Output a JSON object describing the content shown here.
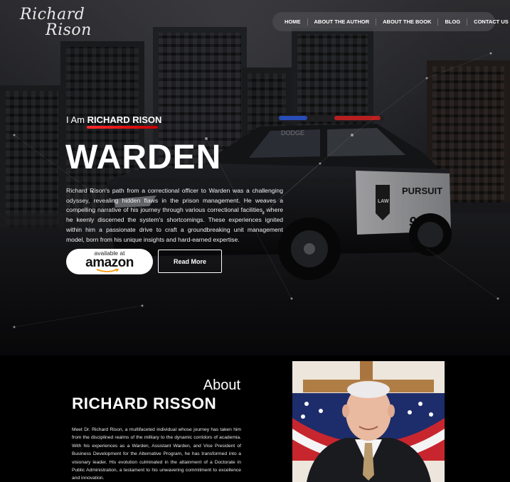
{
  "logo": {
    "line1": "Richard",
    "line2": "Rison"
  },
  "nav": [
    "HOME",
    "ABOUT THE AUTHOR",
    "ABOUT THE BOOK",
    "BLOG",
    "CONTACT US"
  ],
  "hero": {
    "i_am": "I Am",
    "name": "RICHARD RISON",
    "title": "WARDEN",
    "paragraph": "Richard Rison's path from a correctional officer to Warden was a challenging odyssey, revealing hidden flaws in the prison management. He weaves a compelling narrative of his journey through various correctional facilities, where he keenly discerned the system's shortcomings. These experiences ignited within him a passionate drive to craft a groundbreaking unit management model, born from his unique insights and hard-earned expertise.",
    "amazon_small": "available at",
    "amazon_big": "amazon",
    "read_more": "Read More"
  },
  "about": {
    "sub": "About",
    "name": "RICHARD RISSON",
    "paragraph": "Meet Dr. Richard Rison, a multifaceted individual whose journey has taken him from the disciplined realms of the military to the dynamic corridors of academia. With his experiences as a Warden, Assistant Warden, and Vice President of Business Development for the Alternative Program, he has transformed into a visionary leader. His evolution culminated in the attainment of a Doctorate in Public Administration, a testament to his unwavering commitment to excellence and innovation."
  },
  "car_labels": {
    "brand": "DODGE",
    "pursuit": "PURSUIT",
    "unit": "911",
    "badge": "LAW"
  },
  "colors": {
    "accent_red": "#e01b1b",
    "nav_bg": "#4b4b50",
    "amazon_orange": "#f59a12"
  }
}
